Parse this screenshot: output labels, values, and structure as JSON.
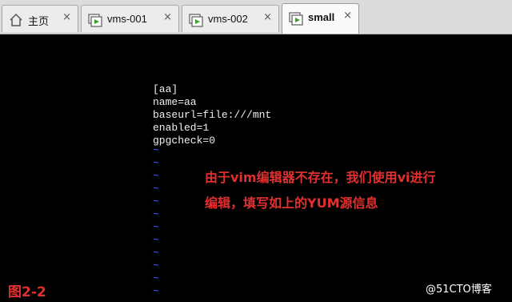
{
  "tabs": [
    {
      "label": "主页",
      "icon": "home-icon",
      "close": "×"
    },
    {
      "label": "vms-001",
      "icon": "vm-icon",
      "close": "×"
    },
    {
      "label": "vms-002",
      "icon": "vm-icon",
      "close": "×"
    },
    {
      "label": "small",
      "icon": "vm-icon",
      "close": "×",
      "active": true
    }
  ],
  "terminal": {
    "lines": [
      "[aa]",
      "name=aa",
      "baseurl=file:///mnt",
      "enabled=1",
      "gpgcheck=0"
    ],
    "tilde": "~"
  },
  "annotation": {
    "line1": "由于vim编辑器不存在，我们使用vi进行",
    "line2": "编辑，填写如上的YUM源信息"
  },
  "figure_label": "图2-2",
  "watermark": "@51CTO博客",
  "colors": {
    "annotation": "#e03030",
    "tilde": "#4a6cff",
    "vm_play": "#3aa02a"
  }
}
